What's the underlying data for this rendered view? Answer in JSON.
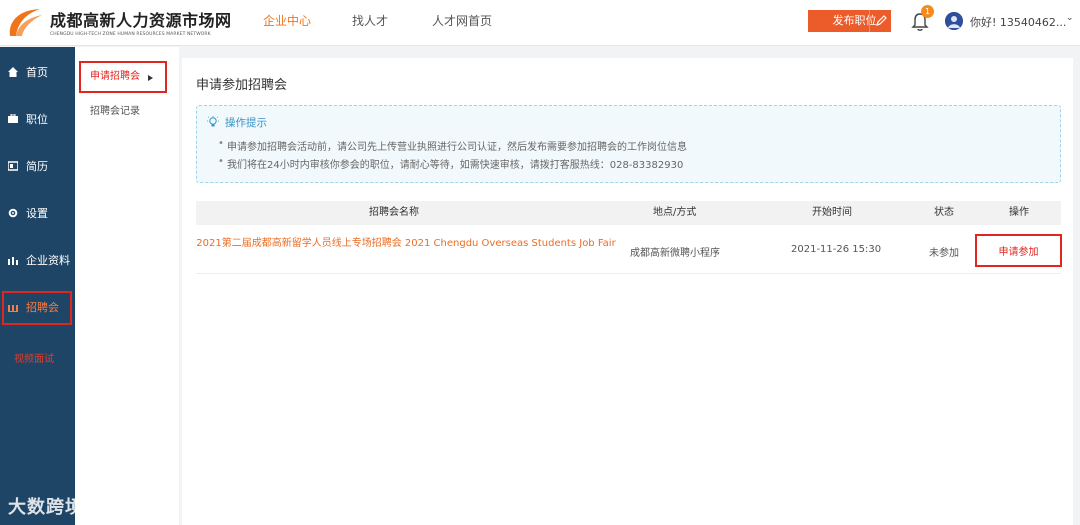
{
  "header": {
    "logo_cn": "成都高新人力资源市场网",
    "logo_en": "CHENGDU HIGH-TECH ZONE HUMAN RESOURCES MARKET NETWORK",
    "nav": [
      {
        "label": "企业中心",
        "active": true
      },
      {
        "label": "找人才",
        "active": false
      },
      {
        "label": "人才网首页",
        "active": false
      }
    ],
    "publish_label": "发布职位",
    "notification_count": "1",
    "greeting": "你好! 13540462..."
  },
  "sidebar": {
    "items": [
      {
        "label": "首页",
        "icon": "home-icon"
      },
      {
        "label": "职位",
        "icon": "briefcase-icon"
      },
      {
        "label": "简历",
        "icon": "resume-icon"
      },
      {
        "label": "设置",
        "icon": "gear-icon"
      },
      {
        "label": "企业资料",
        "icon": "chart-icon"
      },
      {
        "label": "招聘会",
        "icon": "chart-icon",
        "active": true
      }
    ],
    "note": "视频面试"
  },
  "subnav": {
    "items": [
      {
        "label": "申请招聘会",
        "active": true
      },
      {
        "label": "招聘会记录",
        "active": false
      }
    ]
  },
  "main": {
    "title": "申请参加招聘会",
    "tips": {
      "heading": "操作提示",
      "items": [
        "申请参加招聘会活动前，请公司先上传营业执照进行公司认证，然后发布需要参加招聘会的工作岗位信息",
        "我们将在24小时内审核你参会的职位，请耐心等待，如需快速审核，请拨打客服热线：028-83382930"
      ]
    },
    "table": {
      "columns": [
        "招聘会名称",
        "地点/方式",
        "开始时间",
        "状态",
        "操作"
      ],
      "rows": [
        {
          "name": "2021第二届成都高新留学人员线上专场招聘会 2021 Chengdu Overseas Students Job Fair",
          "location": "成都高新微聘小程序",
          "start_time": "2021-11-26 15:30",
          "status": "未参加",
          "action": "申请参加"
        }
      ]
    }
  },
  "watermark": "大数跨境",
  "colors": {
    "accent": "#f0741a",
    "sidebar_bg": "#1f4566",
    "highlight_border": "#e0271f",
    "publish_bg": "#ec5b2a"
  }
}
